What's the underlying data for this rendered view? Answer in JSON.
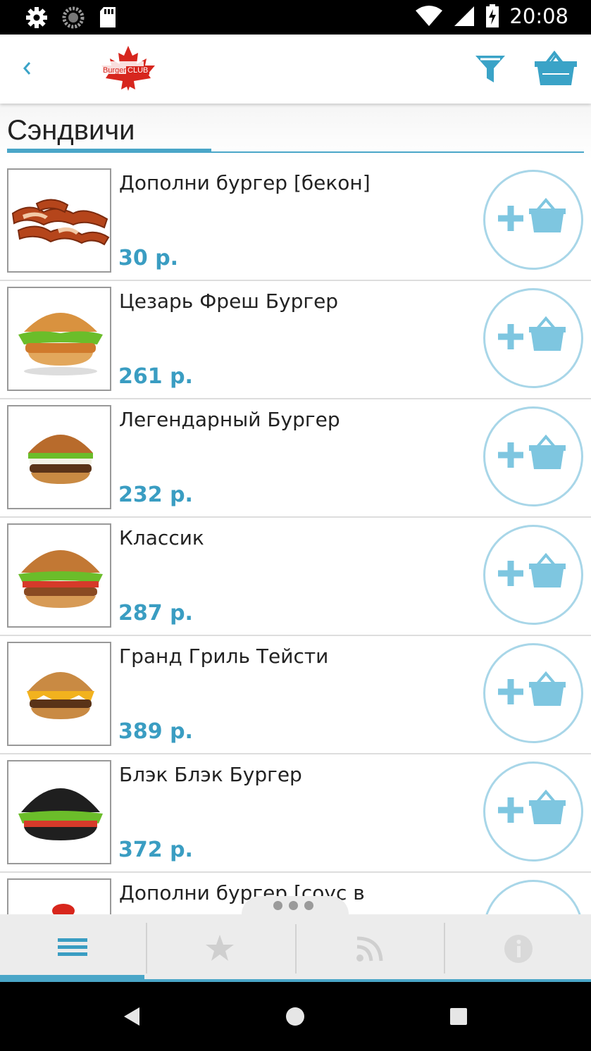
{
  "status_bar": {
    "time": "20:08",
    "icons": [
      "gear-icon",
      "loading-icon",
      "sd-card-icon",
      "wifi-icon",
      "signal-icon",
      "battery-charging-icon"
    ]
  },
  "app_bar": {
    "back_icon": "chevron-left-icon",
    "logo_text_left": "Burger",
    "logo_text_right": "CLUB",
    "filter_icon": "funnel-icon",
    "cart_icon": "basket-icon"
  },
  "section": {
    "title": "Сэндвичи"
  },
  "colors": {
    "accent": "#3a9dc2",
    "button_ring": "#a8d6e8",
    "basket": "#7ec6e0"
  },
  "items": [
    {
      "name": "Дополни бургер [бекон]",
      "price": "30 р."
    },
    {
      "name": "Цезарь Фреш Бургер",
      "price": "261 р."
    },
    {
      "name": "Легендарный Бургер",
      "price": "232 р."
    },
    {
      "name": "Классик",
      "price": "287 р."
    },
    {
      "name": "Гранд Гриль Тейсти",
      "price": "389 р."
    },
    {
      "name": "Блэк Блэк Бургер",
      "price": "372 р."
    },
    {
      "name": "Дополни бургер [соус в",
      "price": ""
    }
  ],
  "tab_bar": {
    "tabs": [
      {
        "icon": "menu-icon",
        "active": true
      },
      {
        "icon": "star-icon",
        "active": false
      },
      {
        "icon": "rss-icon",
        "active": false
      },
      {
        "icon": "info-icon",
        "active": false
      }
    ]
  },
  "nav_bar": {
    "icons": [
      "back-triangle-icon",
      "home-circle-icon",
      "recents-square-icon"
    ]
  }
}
